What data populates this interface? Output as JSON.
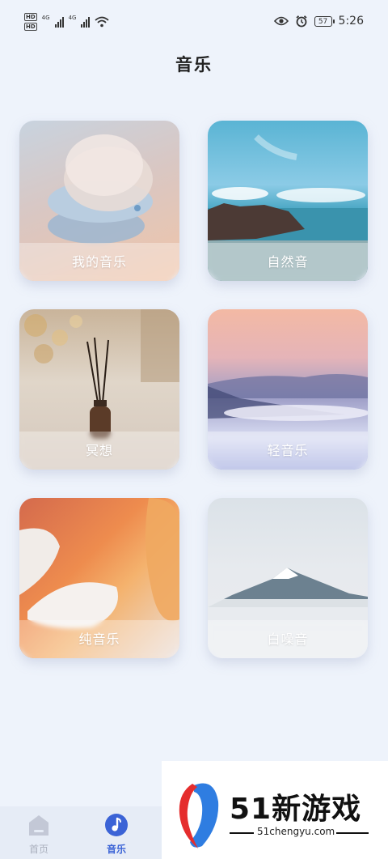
{
  "status_bar": {
    "net_left_top": "HD",
    "net_left_bottom": "HD",
    "sig1_label": "4G",
    "sig2_label": "4G",
    "battery": "57",
    "time": "5:26"
  },
  "page": {
    "title": "音乐"
  },
  "cards": [
    {
      "label": "我的音乐"
    },
    {
      "label": "自然音"
    },
    {
      "label": "冥想"
    },
    {
      "label": "轻音乐"
    },
    {
      "label": "纯音乐"
    },
    {
      "label": "白噪音"
    }
  ],
  "tabbar": {
    "home_label": "首页",
    "music_label": "音乐",
    "active_color": "#3b63d6",
    "inactive_color": "#aab0bd"
  },
  "watermark": {
    "text": "51新游戏",
    "url": "51chengyu.com"
  }
}
